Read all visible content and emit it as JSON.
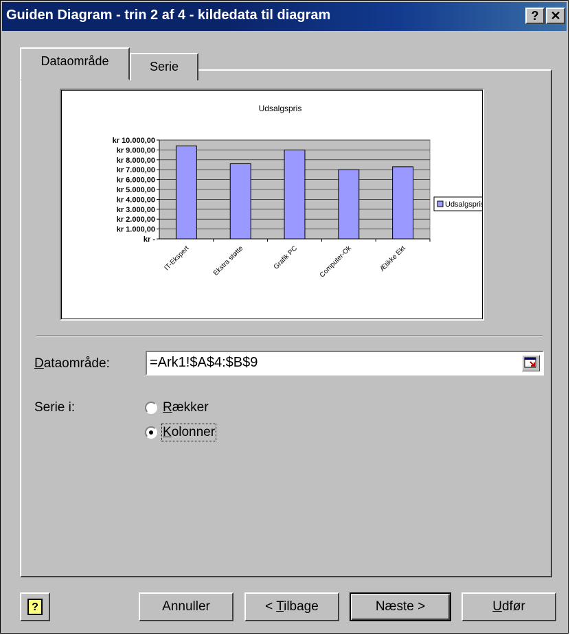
{
  "window": {
    "title": "Guiden Diagram - trin 2 af 4 - kildedata til diagram",
    "help_glyph": "?",
    "close_glyph": "✕"
  },
  "tabs": [
    {
      "label": "Dataområde",
      "active": true
    },
    {
      "label": "Serie",
      "active": false
    }
  ],
  "chart_data": {
    "type": "bar",
    "title": "Udsalgspris",
    "categories": [
      "IT-Ekspert",
      "Ekstra støtte",
      "Grafik PC",
      "Computer-Ok",
      "Ætikke Ekt"
    ],
    "series": [
      {
        "name": "Udsalgspris",
        "values": [
          9400,
          7600,
          9000,
          7000,
          7300
        ]
      }
    ],
    "ylim": [
      0,
      10000
    ],
    "yticks": [
      "kr -",
      "kr 1.000,00",
      "kr 2.000,00",
      "kr 3.000,00",
      "kr 4.000,00",
      "kr 5.000,00",
      "kr 6.000,00",
      "kr 7.000,00",
      "kr 8.000,00",
      "kr 9.000,00",
      "kr 10.000,00"
    ],
    "grid": true,
    "legend": "right",
    "colors": {
      "bar": "#9999ff",
      "plot_bg": "#c0c0c0"
    }
  },
  "form": {
    "range_label_u": "D",
    "range_label_rest": "ataområde:",
    "range_value": "=Ark1!$A$4:$B$9",
    "series_in_label": "Serie i:",
    "rows_u": "R",
    "rows_rest": "ækker",
    "cols_u": "K",
    "cols_rest": "olonner",
    "selected": "cols"
  },
  "buttons": {
    "help_glyph": "?",
    "cancel": "Annuller",
    "back_pre": "< ",
    "back_u": "T",
    "back_rest": "ilbage",
    "next": "Næste >",
    "finish_u": "U",
    "finish_rest": "dfør"
  }
}
